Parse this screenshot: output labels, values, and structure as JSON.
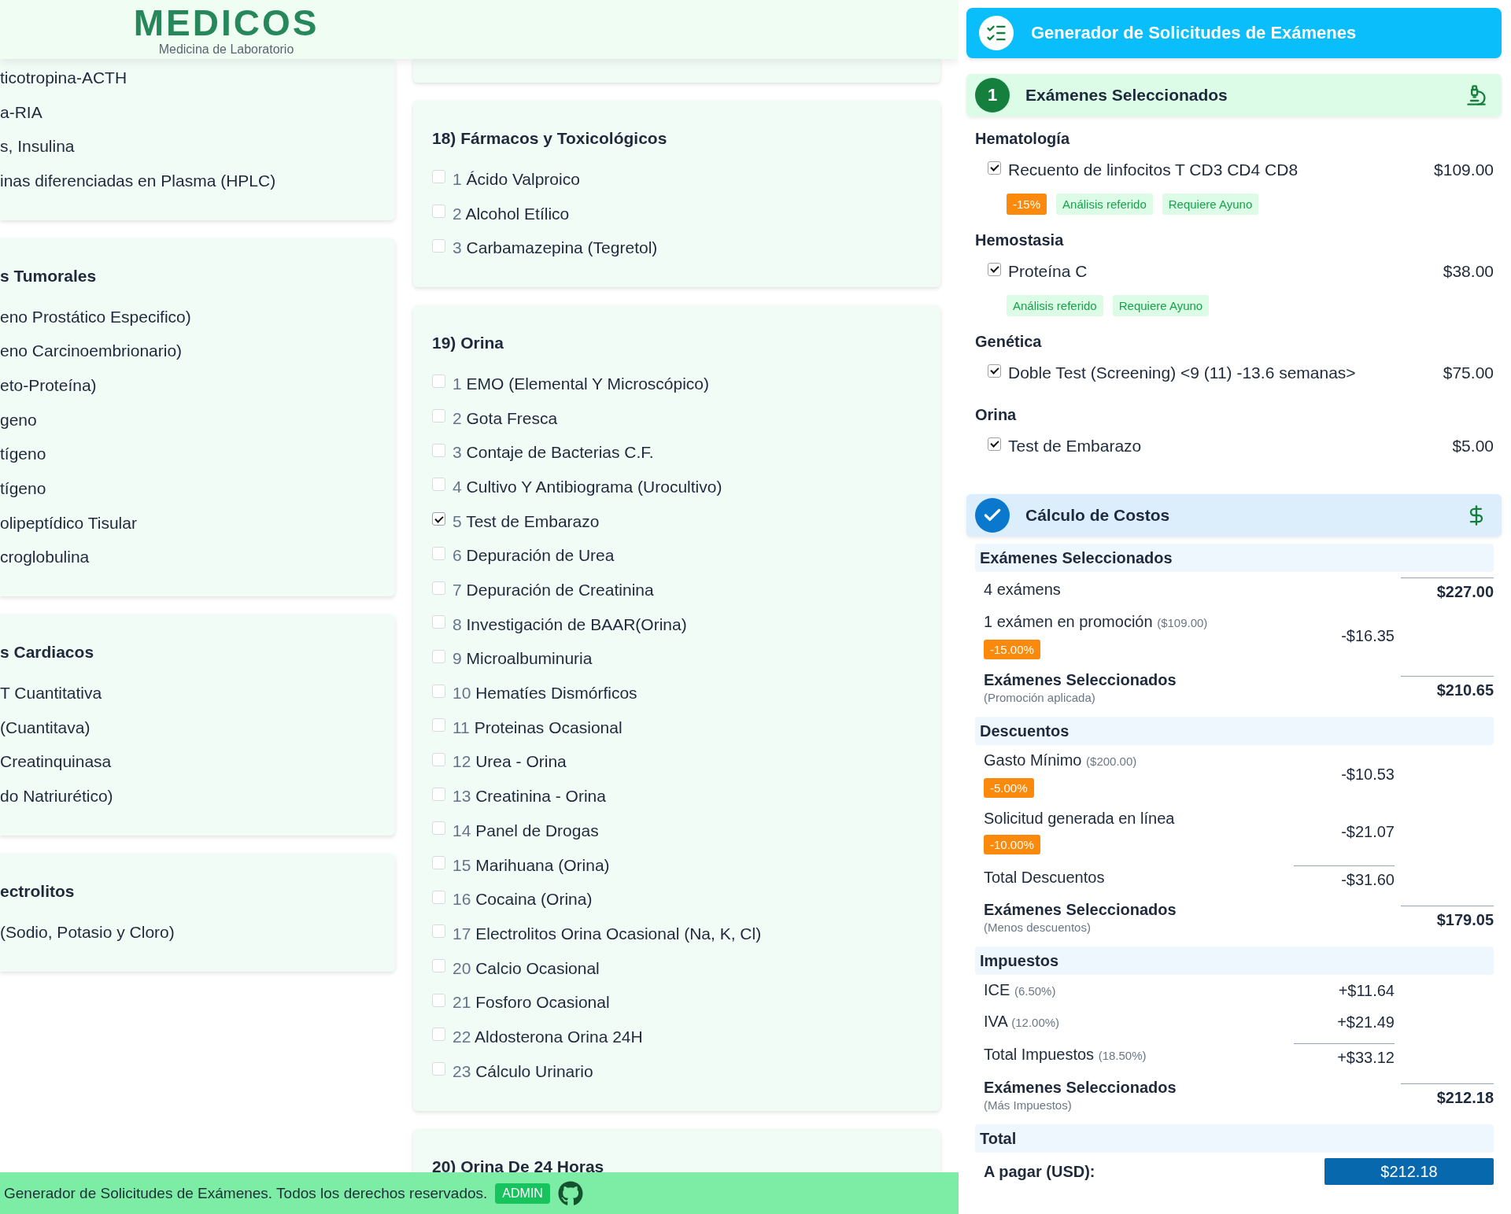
{
  "header": {
    "logo": "MEDICOS",
    "tagline": "Medicina de Laboratorio"
  },
  "left_column": [
    {
      "items": [
        "ticotropina-ACTH",
        "a-RIA",
        "s, Insulina",
        "inas diferenciadas en Plasma (HPLC)"
      ]
    },
    {
      "title": "s Tumorales",
      "items": [
        "eno Prostático Especifico)",
        "eno Carcinoembrionario)",
        "eto-Proteína)",
        "geno",
        "tígeno",
        "tígeno",
        "olipeptídico Tisular",
        "croglobulina"
      ]
    },
    {
      "title": "s Cardiacos",
      "items": [
        "T Cuantitativa",
        "(Cuantitava)",
        "Creatinquinasa",
        "do Natriurético)"
      ]
    },
    {
      "title": "ectrolitos",
      "items": [
        "(Sodio, Potasio y Cloro)"
      ]
    }
  ],
  "middle_column": [
    {
      "title": "18) Fármacos y Toxicológicos",
      "items": [
        {
          "number": "1",
          "name": "Ácido Valproico",
          "checked": false
        },
        {
          "number": "2",
          "name": "Alcohol Etílico",
          "checked": false
        },
        {
          "number": "3",
          "name": "Carbamazepina (Tegretol)",
          "checked": false
        }
      ]
    },
    {
      "title": "19) Orina",
      "items": [
        {
          "number": "1",
          "name": "EMO (Elemental Y Microscópico)",
          "checked": false
        },
        {
          "number": "2",
          "name": "Gota Fresca",
          "checked": false
        },
        {
          "number": "3",
          "name": "Contaje de Bacterias C.F.",
          "checked": false
        },
        {
          "number": "4",
          "name": "Cultivo Y Antibiograma (Urocultivo)",
          "checked": false
        },
        {
          "number": "5",
          "name": "Test de Embarazo",
          "checked": true
        },
        {
          "number": "6",
          "name": "Depuración de Urea",
          "checked": false
        },
        {
          "number": "7",
          "name": "Depuración de Creatinina",
          "checked": false
        },
        {
          "number": "8",
          "name": "Investigación de BAAR(Orina)",
          "checked": false
        },
        {
          "number": "9",
          "name": "Microalbuminuria",
          "checked": false
        },
        {
          "number": "10",
          "name": "Hematíes Dismórficos",
          "checked": false
        },
        {
          "number": "11",
          "name": "Proteinas Ocasional",
          "checked": false
        },
        {
          "number": "12",
          "name": "Urea - Orina",
          "checked": false
        },
        {
          "number": "13",
          "name": "Creatinina - Orina",
          "checked": false
        },
        {
          "number": "14",
          "name": "Panel de Drogas",
          "checked": false
        },
        {
          "number": "15",
          "name": "Marihuana (Orina)",
          "checked": false
        },
        {
          "number": "16",
          "name": "Cocaina (Orina)",
          "checked": false
        },
        {
          "number": "17",
          "name": "Electrolitos Orina Ocasional (Na, K, Cl)",
          "checked": false
        },
        {
          "number": "20",
          "name": "Calcio Ocasional",
          "checked": false
        },
        {
          "number": "21",
          "name": "Fosforo Ocasional",
          "checked": false
        },
        {
          "number": "22",
          "name": "Aldosterona Orina 24H",
          "checked": false
        },
        {
          "number": "23",
          "name": "Cálculo Urinario",
          "checked": false
        }
      ]
    },
    {
      "title": "20) Orina De 24 Horas"
    }
  ],
  "panel": {
    "title": "Generador de Solicitudes de Exámenes",
    "selection": {
      "step": "1",
      "title": "Exámenes Seleccionados",
      "groups": [
        {
          "name": "Hematología",
          "exams": [
            {
              "name": "Recuento de linfocitos T CD3 CD4 CD8",
              "price": "$109.00",
              "checked": true,
              "tags": [
                {
                  "label": "-15%",
                  "kind": "discount"
                },
                {
                  "label": "Análisis referido",
                  "kind": "info"
                },
                {
                  "label": "Requiere Ayuno",
                  "kind": "info"
                }
              ]
            }
          ]
        },
        {
          "name": "Hemostasia",
          "exams": [
            {
              "name": "Proteína C",
              "price": "$38.00",
              "checked": true,
              "tags": [
                {
                  "label": "Análisis referido",
                  "kind": "info"
                },
                {
                  "label": "Requiere Ayuno",
                  "kind": "info"
                }
              ]
            }
          ]
        },
        {
          "name": "Genética",
          "exams": [
            {
              "name": "Doble Test (Screening) <9 (11) -13.6 semanas>",
              "price": "$75.00",
              "checked": true
            }
          ]
        },
        {
          "name": "Orina",
          "exams": [
            {
              "name": "Test de Embarazo",
              "price": "$5.00",
              "checked": true
            }
          ]
        }
      ]
    },
    "costs": {
      "title": "Cálculo de Costos",
      "completed": true,
      "sections": [
        {
          "title": "Exámenes Seleccionados",
          "rows": [
            {
              "kind": "count",
              "label": "4 exámens",
              "total": "$227.00"
            },
            {
              "kind": "item",
              "label": "1 exámen en promoción",
              "note": "($109.00)",
              "badge": "-15.00%",
              "amount": "-$16.35"
            },
            {
              "kind": "subtotal",
              "label": "Exámenes Seleccionados",
              "note": "(Promoción aplicada)",
              "total": "$210.65"
            }
          ]
        },
        {
          "title": "Descuentos",
          "rows": [
            {
              "kind": "item",
              "label": "Gasto Mínimo",
              "note": "($200.00)",
              "badge": "-5.00%",
              "amount": "-$10.53"
            },
            {
              "kind": "item",
              "label": "Solicitud generada en línea",
              "badge": "-10.00%",
              "amount": "-$21.07"
            },
            {
              "kind": "sum",
              "label": "Total Descuentos",
              "amount": "-$31.60"
            },
            {
              "kind": "subtotal",
              "label": "Exámenes Seleccionados",
              "note": "(Menos descuentos)",
              "total": "$179.05"
            }
          ]
        },
        {
          "title": "Impuestos",
          "rows": [
            {
              "kind": "item",
              "label": "ICE",
              "note": "(6.50%)",
              "amount": "+$11.64"
            },
            {
              "kind": "item",
              "label": "IVA",
              "note": "(12.00%)",
              "amount": "+$21.49"
            },
            {
              "kind": "sum",
              "label": "Total Impuestos",
              "note": "(18.50%)",
              "amount": "+$33.12"
            },
            {
              "kind": "subtotal",
              "label": "Exámenes Seleccionados",
              "note": "(Más Impuestos)",
              "total": "$212.18"
            }
          ]
        },
        {
          "title": "Total",
          "rows": [
            {
              "kind": "payable",
              "label": "A pagar (USD):",
              "total": "$212.18"
            }
          ]
        }
      ]
    }
  },
  "footer": {
    "text": "Generador de Solicitudes de Exámenes. Todos los derechos reservados.",
    "badge": "ADMIN"
  }
}
